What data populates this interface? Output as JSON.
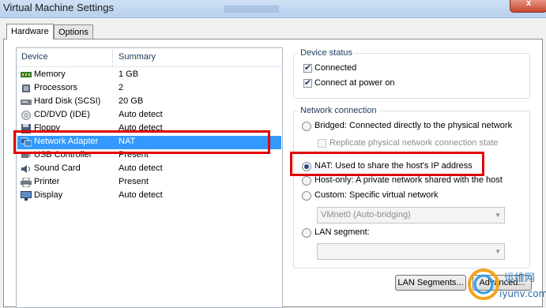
{
  "window": {
    "title": "Virtual Machine Settings",
    "close_glyph": "x"
  },
  "tabs": [
    {
      "label": "Hardware"
    },
    {
      "label": "Options"
    }
  ],
  "device_list": {
    "headers": {
      "device": "Device",
      "summary": "Summary"
    },
    "rows": [
      {
        "name": "Memory",
        "summary": "1 GB",
        "icon": "memory-icon"
      },
      {
        "name": "Processors",
        "summary": "2",
        "icon": "processor-icon"
      },
      {
        "name": "Hard Disk (SCSI)",
        "summary": "20 GB",
        "icon": "hard-disk-icon"
      },
      {
        "name": "CD/DVD (IDE)",
        "summary": "Auto detect",
        "icon": "cd-dvd-icon"
      },
      {
        "name": "Floppy",
        "summary": "Auto detect",
        "icon": "floppy-icon"
      },
      {
        "name": "Network Adapter",
        "summary": "NAT",
        "icon": "network-adapter-icon",
        "selected": true
      },
      {
        "name": "USB Controller",
        "summary": "Present",
        "icon": "usb-icon"
      },
      {
        "name": "Sound Card",
        "summary": "Auto detect",
        "icon": "sound-icon"
      },
      {
        "name": "Printer",
        "summary": "Present",
        "icon": "printer-icon"
      },
      {
        "name": "Display",
        "summary": "Auto detect",
        "icon": "display-icon"
      }
    ]
  },
  "device_status": {
    "legend": "Device status",
    "connected": {
      "label": "Connected",
      "checked": true
    },
    "connect_at_power_on": {
      "label": "Connect at power on",
      "checked": true
    }
  },
  "network_connection": {
    "legend": "Network connection",
    "bridged": {
      "label": "Bridged: Connected directly to the physical network",
      "selected": false
    },
    "replicate": {
      "label": "Replicate physical network connection state",
      "checked": false,
      "enabled": false
    },
    "nat": {
      "label": "NAT: Used to share the host's IP address",
      "selected": true
    },
    "host_only": {
      "label": "Host-only: A private network shared with the host",
      "selected": false
    },
    "custom": {
      "label": "Custom: Specific virtual network",
      "selected": false
    },
    "custom_combo_value": "VMnet0 (Auto-bridging)",
    "lan_segment": {
      "label": "LAN segment:",
      "selected": false
    },
    "lan_segment_combo_value": ""
  },
  "buttons": {
    "lan_segments": "LAN Segments...",
    "advanced": "Advanced..."
  },
  "watermark": {
    "cn": "运维网",
    "url": "iyunv.com"
  },
  "colors": {
    "selection": "#3399ff",
    "highlight_box": "#e00000"
  }
}
